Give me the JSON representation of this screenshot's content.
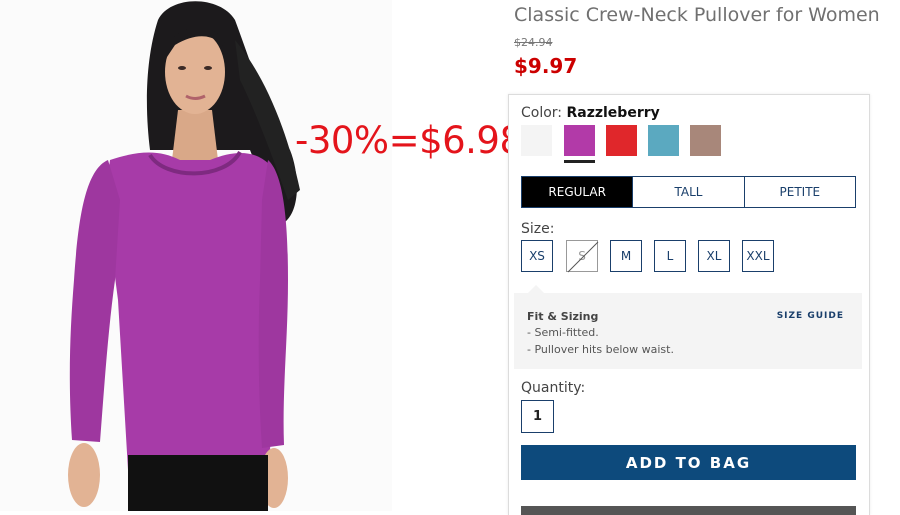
{
  "product": {
    "title": "Classic Crew-Neck Pullover for Women",
    "old_price": "$24.94",
    "sale_price": "$9.97"
  },
  "promo_overlay": "-30%=$6.98",
  "color": {
    "label": "Color:",
    "selected": "Razzleberry",
    "swatches": [
      {
        "name": "white",
        "hex": "#f4f4f4",
        "selected": false
      },
      {
        "name": "razzleberry",
        "hex": "#b23aa8",
        "selected": true
      },
      {
        "name": "red",
        "hex": "#e0272b",
        "selected": false
      },
      {
        "name": "teal",
        "hex": "#5ba9c0",
        "selected": false
      },
      {
        "name": "taupe",
        "hex": "#a8877a",
        "selected": false
      }
    ]
  },
  "fits": [
    {
      "label": "REGULAR",
      "active": true
    },
    {
      "label": "TALL",
      "active": false
    },
    {
      "label": "PETITE",
      "active": false
    }
  ],
  "size": {
    "label": "Size:",
    "options": [
      {
        "label": "XS",
        "available": true
      },
      {
        "label": "S",
        "available": false
      },
      {
        "label": "M",
        "available": true
      },
      {
        "label": "L",
        "available": true
      },
      {
        "label": "XL",
        "available": true
      },
      {
        "label": "XXL",
        "available": true
      }
    ]
  },
  "fit_sizing": {
    "title": "Fit & Sizing",
    "guide_link": "SIZE GUIDE",
    "lines": [
      "- Semi-fitted.",
      "- Pullover hits below waist."
    ]
  },
  "quantity": {
    "label": "Quantity:",
    "value": "1"
  },
  "add_button": "ADD TO BAG",
  "colors": {
    "brand_navy": "#0d4a7c",
    "sale_red": "#cc0000",
    "promo_red": "#e4141b"
  }
}
